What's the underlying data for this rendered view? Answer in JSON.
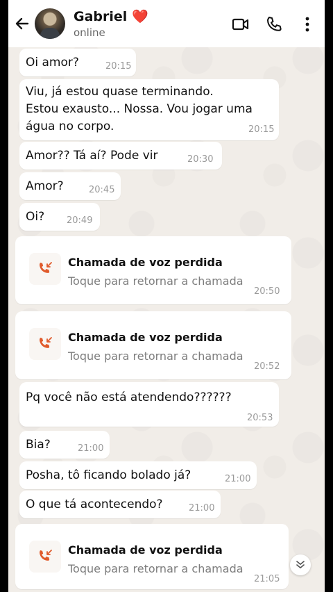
{
  "header": {
    "name": "Gabriel",
    "heart": "❤️",
    "status": "online",
    "icons": [
      "arrow-left-icon",
      "avatar",
      "video-call-icon",
      "phone-icon",
      "more-vert-icon"
    ]
  },
  "messages": [
    {
      "type": "text",
      "lines": [
        "Oi amor?"
      ],
      "time": "20:15"
    },
    {
      "type": "text",
      "lines": [
        "Viu, já estou quase terminando.",
        "Estou exausto... Nossa. Vou jogar uma",
        "água no corpo."
      ],
      "time": "20:15"
    },
    {
      "type": "text",
      "lines": [
        "Amor?? Tá aí? Pode vir"
      ],
      "time": "20:30"
    },
    {
      "type": "text",
      "lines": [
        "Amor?"
      ],
      "time": "20:45"
    },
    {
      "type": "text",
      "lines": [
        "Oi?"
      ],
      "time": "20:49"
    },
    {
      "type": "call",
      "title": "Chamada de voz perdida",
      "subtitle": "Toque para retornar a chamada",
      "time": "20:50"
    },
    {
      "type": "call",
      "title": "Chamada de voz perdida",
      "subtitle": "Toque para retornar a chamada",
      "time": "20:52"
    },
    {
      "type": "text",
      "lines": [
        "Pq você não está atendendo??????"
      ],
      "time": "20:53"
    },
    {
      "type": "text",
      "lines": [
        "Bia?"
      ],
      "time": "21:00"
    },
    {
      "type": "text",
      "lines": [
        "Posha, tô ficando bolado já?"
      ],
      "time": "21:00"
    },
    {
      "type": "text",
      "lines": [
        "O que tá acontecendo?"
      ],
      "time": "21:00"
    },
    {
      "type": "call",
      "title": "Chamada de voz perdida",
      "subtitle": "Toque para retornar a chamada",
      "time": "21:05"
    }
  ],
  "colors": {
    "missed_call": "#e05a2b",
    "header_bg": "#ffffff",
    "chat_bg": "#f1ede8"
  }
}
